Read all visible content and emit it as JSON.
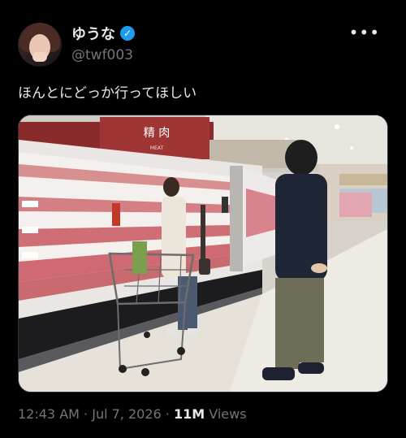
{
  "author": {
    "display_name": "ゆうな",
    "handle": "@twf003",
    "verified": true,
    "avatar_icon": "user-avatar-icon",
    "verified_icon": "verified-badge-icon"
  },
  "menu": {
    "more_icon": "more-options-icon",
    "label": "•••"
  },
  "tweet": {
    "text": "ほんとにどっか行ってほしい",
    "photo": {
      "description_icon": "supermarket-photo",
      "signage": {
        "main_text": "精 肉",
        "sub_text": "MEAT"
      }
    }
  },
  "meta": {
    "time": "12:43 AM",
    "separator1": " · ",
    "date": "Jul 7, 2026",
    "separator2": " · ",
    "views_count": "11M",
    "views_label": " Views"
  }
}
